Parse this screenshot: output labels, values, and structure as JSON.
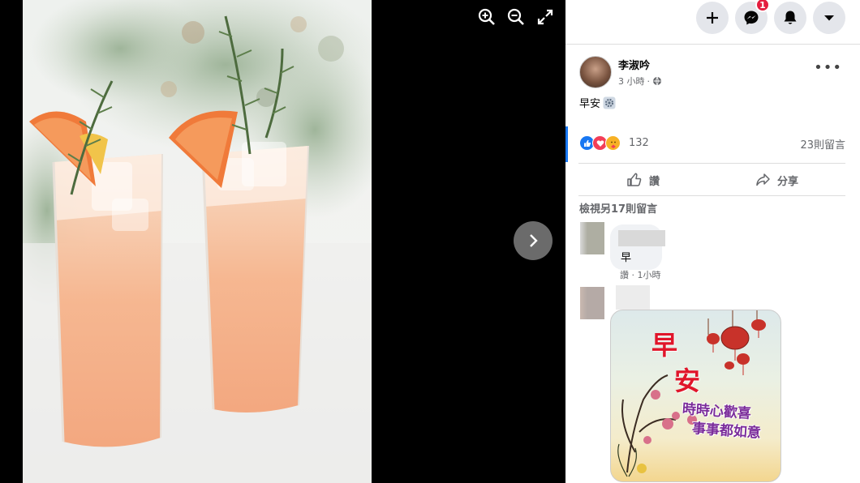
{
  "topbar": {
    "icons": [
      "plus-icon",
      "messenger-icon",
      "bell-icon",
      "caret-down-icon"
    ],
    "messenger_badge": "1"
  },
  "viewer": {
    "tools": [
      "zoom-in-icon",
      "zoom-out-icon",
      "fullscreen-icon"
    ],
    "next_icon": "chevron-right-icon"
  },
  "post": {
    "author": "李淑吟",
    "time": "3 小時",
    "privacy_icon": "globe-icon",
    "text": "早安",
    "reactions": [
      "like",
      "love",
      "care"
    ],
    "reaction_count": "132",
    "comment_count": "23則留言",
    "like_label": "讚",
    "share_label": "分享",
    "view_more": "檢視另17則留言"
  },
  "comments": [
    {
      "text": "早",
      "like_label": "讚",
      "time": "1小時"
    }
  ],
  "sticker": {
    "title_1": "早",
    "title_2": "安",
    "line_1": "時時心歡喜",
    "line_2": "事事都如意"
  },
  "colors": {
    "accent": "#1877f2",
    "badge": "#e41e3f",
    "sticker_red": "#e0152a"
  }
}
